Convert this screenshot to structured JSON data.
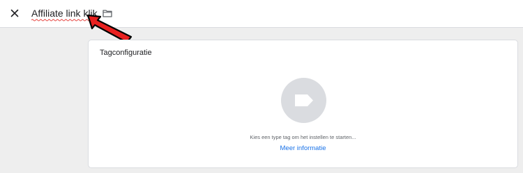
{
  "header": {
    "close_icon": "close-icon",
    "title": "Affiliate link klik",
    "folder_icon": "folder-icon"
  },
  "card": {
    "title": "Tagconfiguratie",
    "tag_icon": "tag-icon",
    "hint": "Kies een type tag om het instellen te starten...",
    "more_link": "Meer informatie"
  },
  "colors": {
    "background": "#eeeeee",
    "header_bg": "#ffffff",
    "circle": "#dadce0",
    "link": "#1a73e8",
    "arrow": "#e8201f",
    "spellcheck": "#e53935"
  }
}
